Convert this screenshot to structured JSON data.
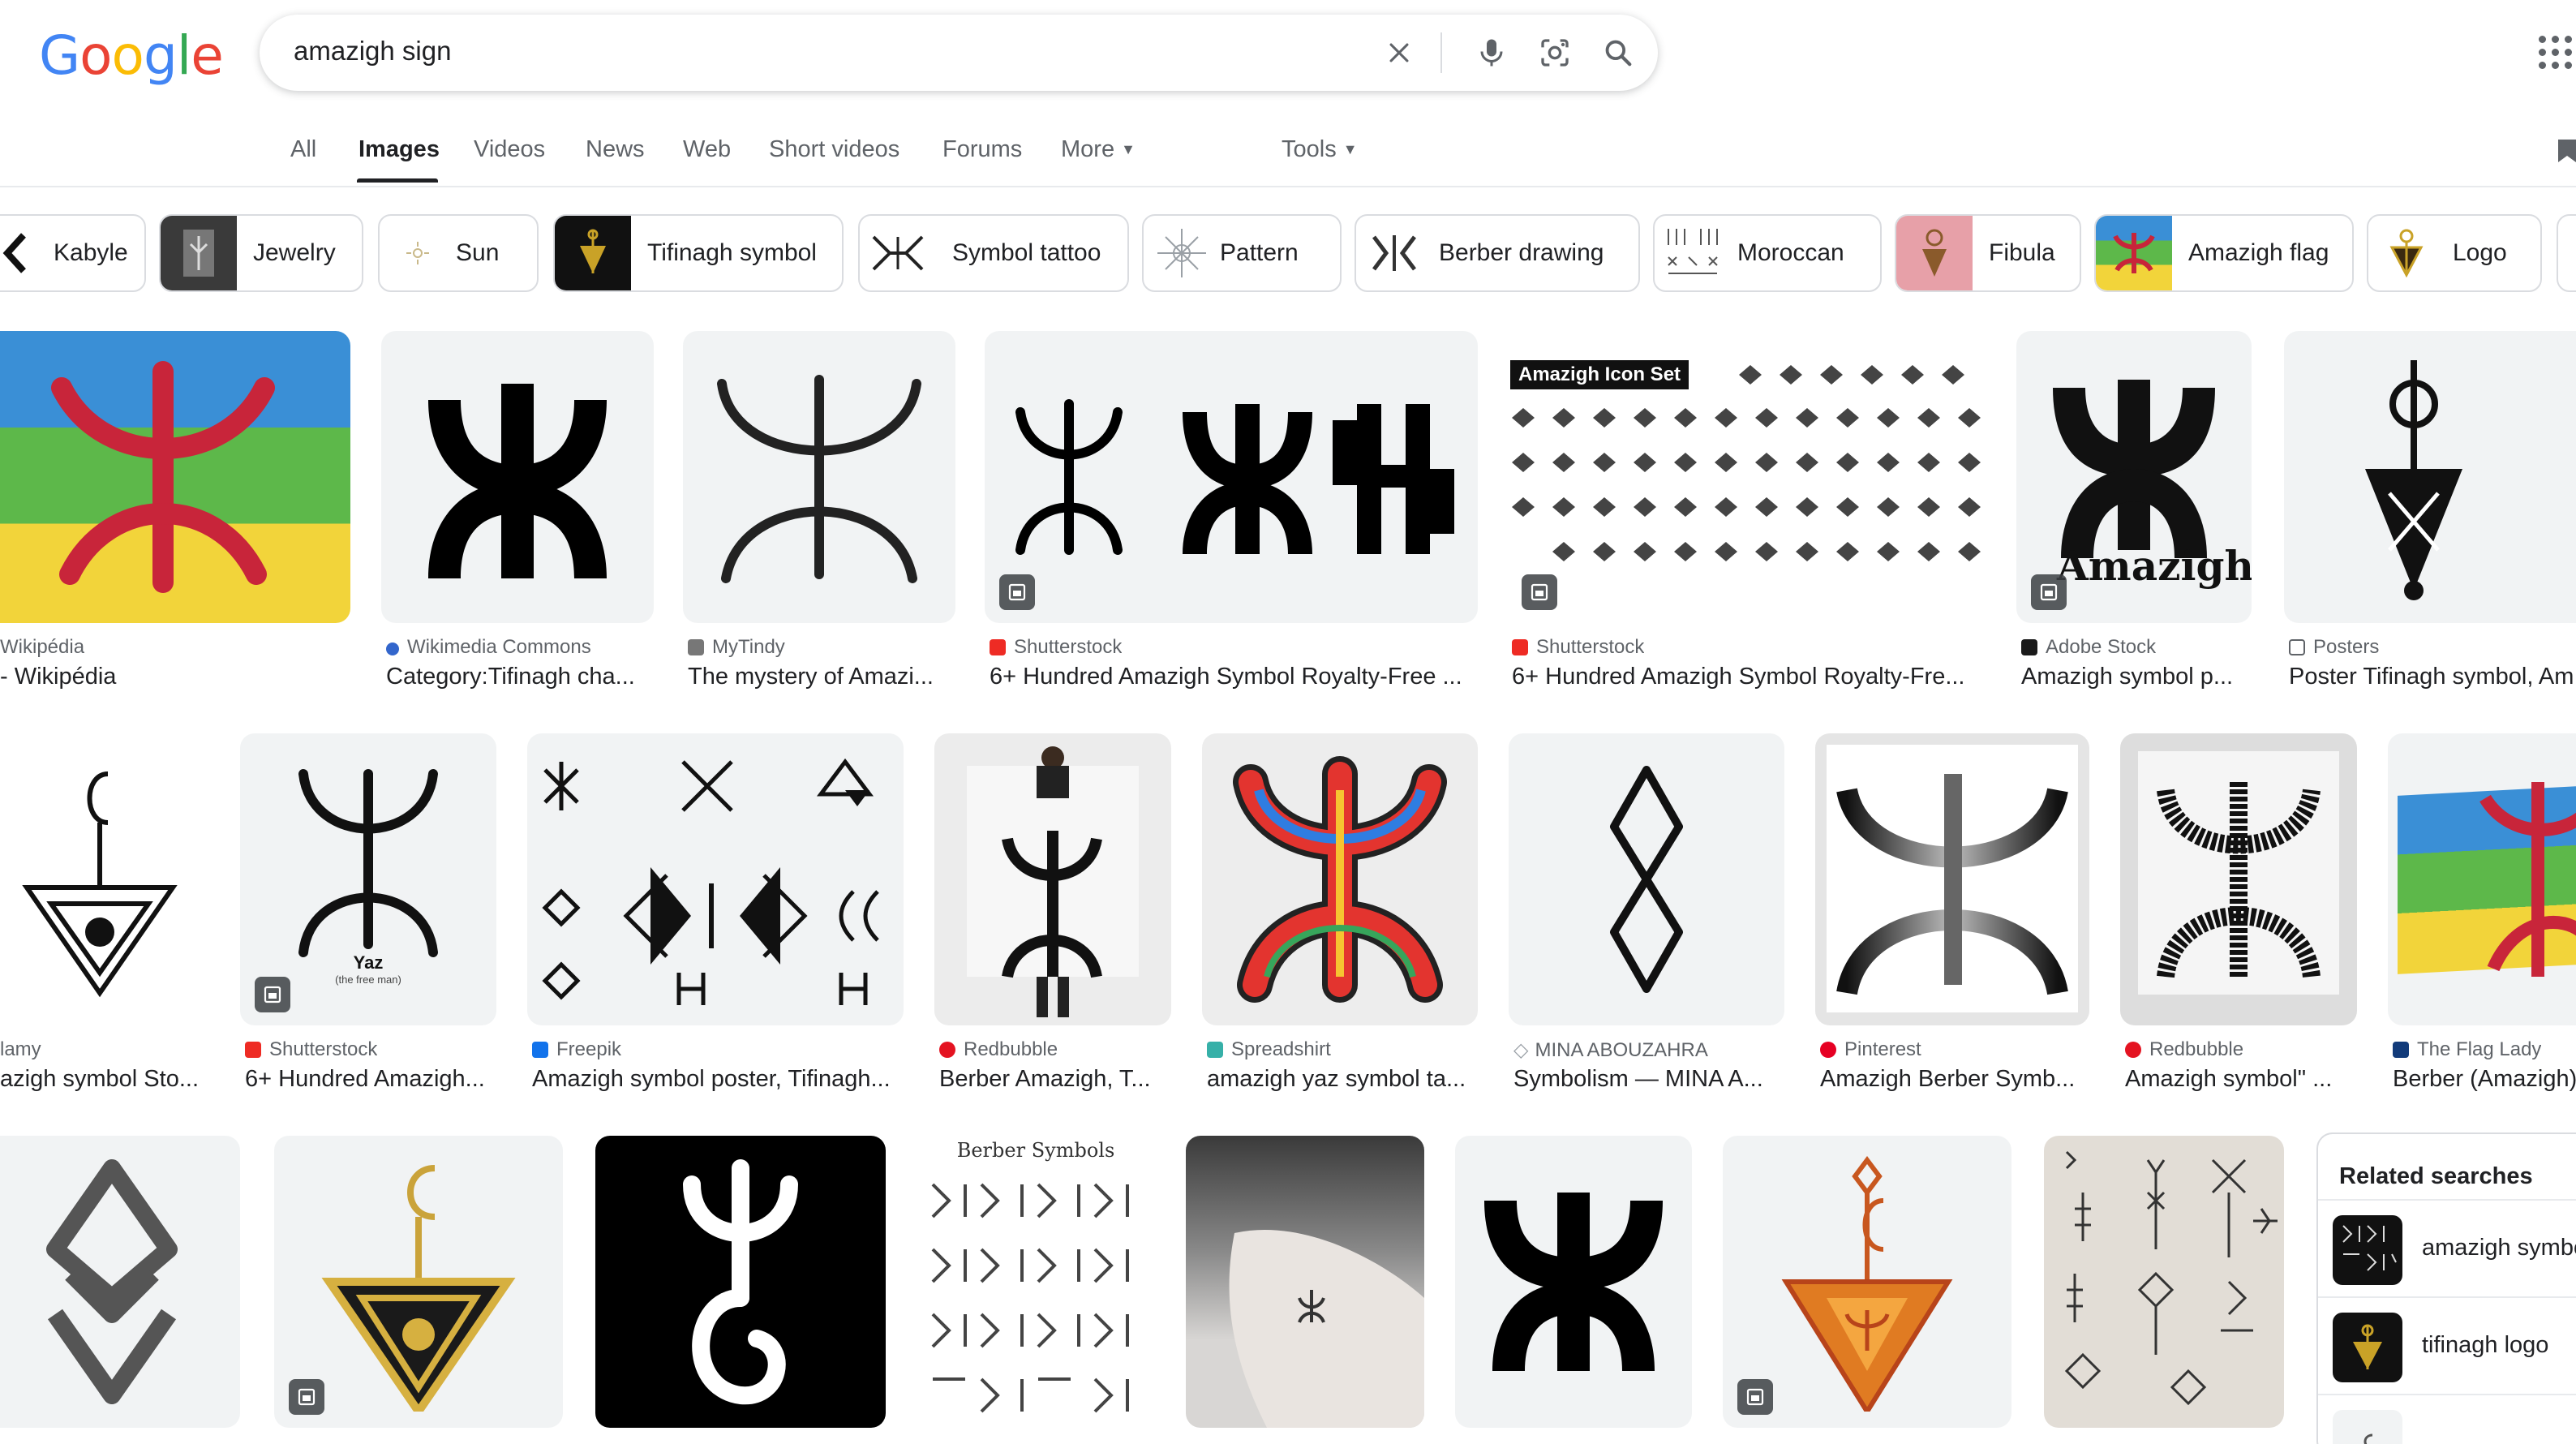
{
  "header": {
    "logo_letters": [
      "G",
      "o",
      "o",
      "g",
      "l",
      "e"
    ],
    "query": "amazigh sign"
  },
  "tabs": [
    "All",
    "Images",
    "Videos",
    "News",
    "Web",
    "Short videos",
    "Forums",
    "More",
    "Tools"
  ],
  "active_tab": "Images",
  "chips": [
    "Kabyle",
    "Jewelry",
    "Sun",
    "Tifinagh symbol",
    "Symbol tattoo",
    "Pattern",
    "Berber drawing",
    "Moroccan",
    "Fibula",
    "Amazigh flag",
    "Logo"
  ],
  "row1": [
    {
      "source": "Wikipédia",
      "title": "- Wikipédia"
    },
    {
      "source": "Wikimedia Commons",
      "title": "Category:Tifinagh cha..."
    },
    {
      "source": "MyTindy",
      "title": "The mystery of Amazi..."
    },
    {
      "source": "Shutterstock",
      "title": "6+ Hundred Amazigh Symbol Royalty-Free ..."
    },
    {
      "source": "Shutterstock",
      "title": "6+ Hundred Amazigh Symbol Royalty-Fre..."
    },
    {
      "source": "Adobe Stock",
      "title": "Amazigh symbol p..."
    },
    {
      "source": "Posters",
      "title": "Poster Tifinagh symbol, Am"
    }
  ],
  "row2": [
    {
      "source": "lamy",
      "title": "azigh symbol Sto..."
    },
    {
      "source": "Shutterstock",
      "title": "6+ Hundred Amazigh..."
    },
    {
      "source": "Freepik",
      "title": "Amazigh symbol poster, Tifinagh..."
    },
    {
      "source": "Redbubble",
      "title": "Berber Amazigh, T..."
    },
    {
      "source": "Spreadshirt",
      "title": "amazigh yaz symbol ta..."
    },
    {
      "source": "MINA ABOUZAHRA",
      "title": "Symbolism — MINA A..."
    },
    {
      "source": "Pinterest",
      "title": "Amazigh Berber Symb..."
    },
    {
      "source": "Redbubble",
      "title": "Amazigh symbol\" ..."
    },
    {
      "source": "The Flag Lady",
      "title": "Berber (Amazigh)"
    }
  ],
  "image_text": {
    "icon_set": "Amazigh Icon Set",
    "amazigh_word": "Amazigh",
    "yaz": "Yaz",
    "yaz_sub": "(the free man)",
    "berber_symbols": "Berber Symbols"
  },
  "related": {
    "title": "Related searches",
    "items": [
      "amazigh symbol",
      "tifinagh logo"
    ]
  },
  "colors": {
    "flag_blue": "#3a8fd6",
    "flag_green": "#5db84a",
    "flag_yellow": "#f2d43a",
    "flag_red": "#c8253a",
    "shutterstock": "#ee2b24",
    "redbubble": "#e41321",
    "pinterest": "#e60023",
    "spreadshirt": "#36b0a8",
    "freepik": "#1273eb",
    "adobe": "#1a1a1a"
  }
}
